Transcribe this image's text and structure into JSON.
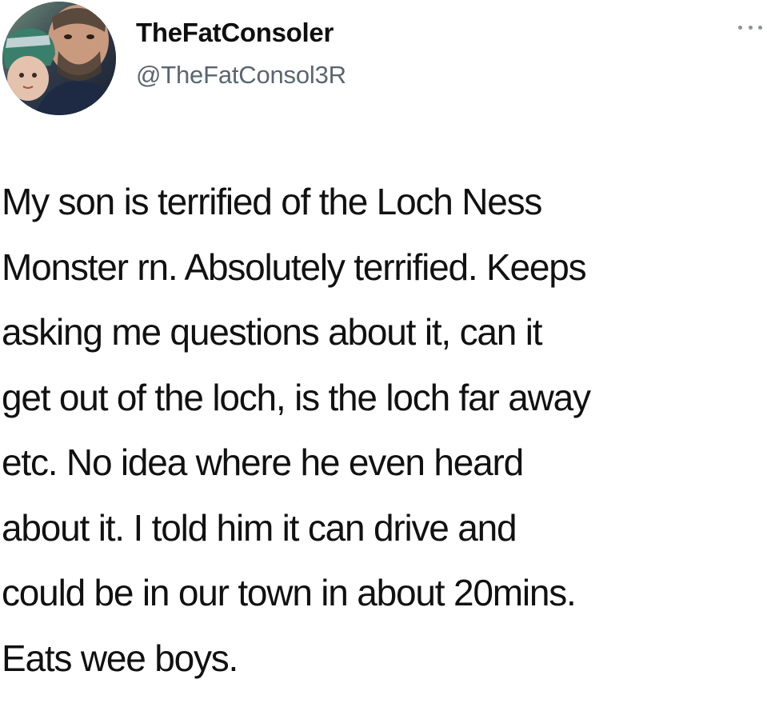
{
  "tweet": {
    "author": {
      "display_name": "TheFatConsoler",
      "handle": "@TheFatConsol3R",
      "avatar_icon": "profile-photo"
    },
    "menu_icon": "more-horizontal-icon",
    "text_lines": [
      "My son is terrified of the Loch Ness",
      "Monster rn. Absolutely terrified. Keeps",
      "asking me questions about it, can it",
      "get out of the loch, is the loch far away",
      "etc. No idea where he even heard",
      "about it. I told him it can drive and",
      "could be in our town in about 20mins.",
      "Eats wee boys."
    ]
  }
}
